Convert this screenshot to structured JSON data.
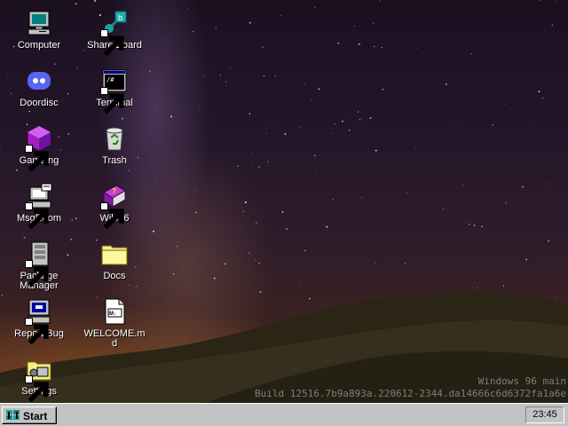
{
  "desktop": {
    "icons": [
      {
        "label": "Computer",
        "icon": "computer-icon"
      },
      {
        "label": "Share Board",
        "icon": "share-board-icon"
      },
      {
        "label": "Doordisc",
        "icon": "doordisc-icon"
      },
      {
        "label": "Terminal",
        "icon": "terminal-icon"
      },
      {
        "label": "Gameing",
        "icon": "gameing-icon"
      },
      {
        "label": "Trash",
        "icon": "trash-icon"
      },
      {
        "label": "MsgRoom",
        "icon": "msgroom-icon"
      },
      {
        "label": "Wiki96",
        "icon": "wiki96-icon"
      },
      {
        "label": "Package",
        "label2": "Manager",
        "icon": "package-manager-icon"
      },
      {
        "label": "Docs",
        "icon": "folder-icon"
      },
      {
        "label": "Report Bug",
        "icon": "report-bug-icon"
      },
      {
        "label": "WELCOME.m",
        "label2": "d",
        "icon": "markdown-file-icon"
      },
      {
        "label": "Settings",
        "icon": "settings-icon"
      }
    ],
    "watermark": {
      "line1": "Windows 96 main",
      "line2": "Build 12516.7b9a893a.220612-2344.da14666c6d6372fa1a6e"
    }
  },
  "taskbar": {
    "start_label": "Start",
    "clock": "23:45"
  },
  "colors": {
    "taskbar": "#c3c3c3",
    "desktop_top": "#1a1020",
    "desktop_glow": "#be6e28",
    "folder": "#f4f088",
    "discord": "#5865f2"
  }
}
